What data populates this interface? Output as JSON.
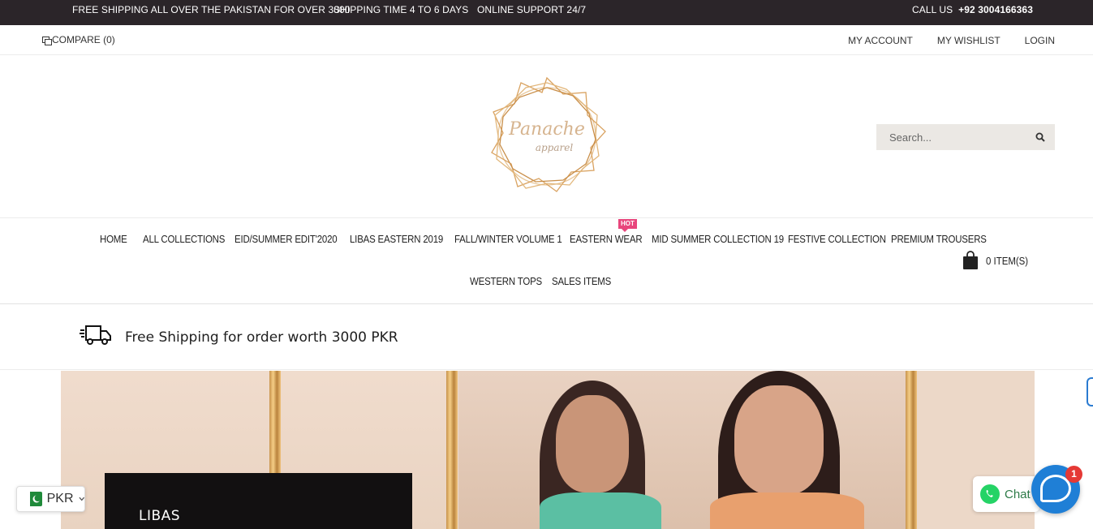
{
  "topbar": {
    "msg1": "FREE SHIPPING ALL OVER THE PAKISTAN FOR OVER 3000",
    "msg2": "SHIPPING TIME 4 TO 6 DAYS",
    "msg3": "ONLINE SUPPORT 24/7",
    "call_label": "CALL US",
    "phone": "+92 3004166363"
  },
  "utility": {
    "compare": "COMPARE (0)",
    "my_account": "MY ACCOUNT",
    "my_wishlist": "MY WISHLIST",
    "login": "LOGIN"
  },
  "header": {
    "logo_line1": "Panache",
    "logo_line2": "apparel",
    "search_placeholder": "Search..."
  },
  "nav": {
    "items": [
      "HOME",
      "ALL COLLECTIONS",
      "EID/SUMMER EDIT'2020",
      "LIBAS EASTERN 2019",
      "FALL/WINTER VOLUME 1",
      "EASTERN WEAR",
      "MID SUMMER COLLECTION 19",
      "FESTIVE COLLECTION",
      "PREMIUM TROUSERS",
      "WESTERN TOPS",
      "SALES ITEMS"
    ],
    "hot_badge": "HOT",
    "cart_label": "0 ITEM(S)"
  },
  "shipping_banner": {
    "text": "Free Shipping for order worth 3000 PKR"
  },
  "hero": {
    "panel_text": "LIBAS"
  },
  "widgets": {
    "currency": "PKR",
    "chat_label": "Chat",
    "chat_badge": "1"
  },
  "colors": {
    "topbar_bg": "#2b2529",
    "hot_badge": "#e8467c",
    "chat_blue": "#1f7fd6",
    "whatsapp_green": "#25d366"
  }
}
